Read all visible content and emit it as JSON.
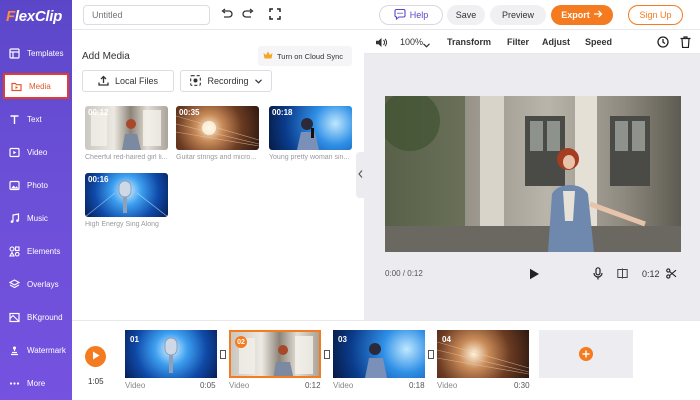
{
  "app": {
    "logo_prefix": "F",
    "logo_rest": "lexClip"
  },
  "sidebar": {
    "items": [
      {
        "label": "Templates",
        "icon": "templates-icon"
      },
      {
        "label": "Media",
        "icon": "media-icon"
      },
      {
        "label": "Text",
        "icon": "text-icon"
      },
      {
        "label": "Video",
        "icon": "video-icon"
      },
      {
        "label": "Photo",
        "icon": "photo-icon"
      },
      {
        "label": "Music",
        "icon": "music-icon"
      },
      {
        "label": "Elements",
        "icon": "elements-icon"
      },
      {
        "label": "Overlays",
        "icon": "overlays-icon"
      },
      {
        "label": "BKground",
        "icon": "background-icon"
      },
      {
        "label": "Watermark",
        "icon": "watermark-icon"
      },
      {
        "label": "More",
        "icon": "more-icon"
      }
    ],
    "active_index": 1
  },
  "topbar": {
    "title_placeholder": "Untitled",
    "help_label": "Help",
    "save_label": "Save",
    "preview_label": "Preview",
    "export_label": "Export",
    "signup_label": "Sign Up"
  },
  "panel": {
    "heading": "Add Media",
    "cloud_sync_label": "Turn on Cloud Sync",
    "local_files_label": "Local Files",
    "recording_label": "Recording",
    "media": [
      {
        "time": "00:12",
        "caption": "Cheerful red-haired girl li..."
      },
      {
        "time": "00:35",
        "caption": "Guitar strings and micro..."
      },
      {
        "time": "00:18",
        "caption": "Young pretty woman sin..."
      },
      {
        "time": "00:16",
        "caption": "High Energy Sing Along"
      }
    ]
  },
  "toolbar": {
    "zoom": "100%",
    "transform": "Transform",
    "filter": "Filter",
    "adjust": "Adjust",
    "speed": "Speed"
  },
  "player": {
    "current_total": "0:00 / 0:12",
    "clip_duration": "0:12"
  },
  "timeline": {
    "total_time": "1:05",
    "clips": [
      {
        "num": "01",
        "type": "Video",
        "duration": "0:05"
      },
      {
        "num": "02",
        "type": "Video",
        "duration": "0:12"
      },
      {
        "num": "03",
        "type": "Video",
        "duration": "0:18"
      },
      {
        "num": "04",
        "type": "Video",
        "duration": "0:30"
      }
    ],
    "selected_index": 1
  },
  "colors": {
    "accent": "#f47b20",
    "sidebar": "#5b46c8",
    "active_border": "#e43a2f"
  }
}
